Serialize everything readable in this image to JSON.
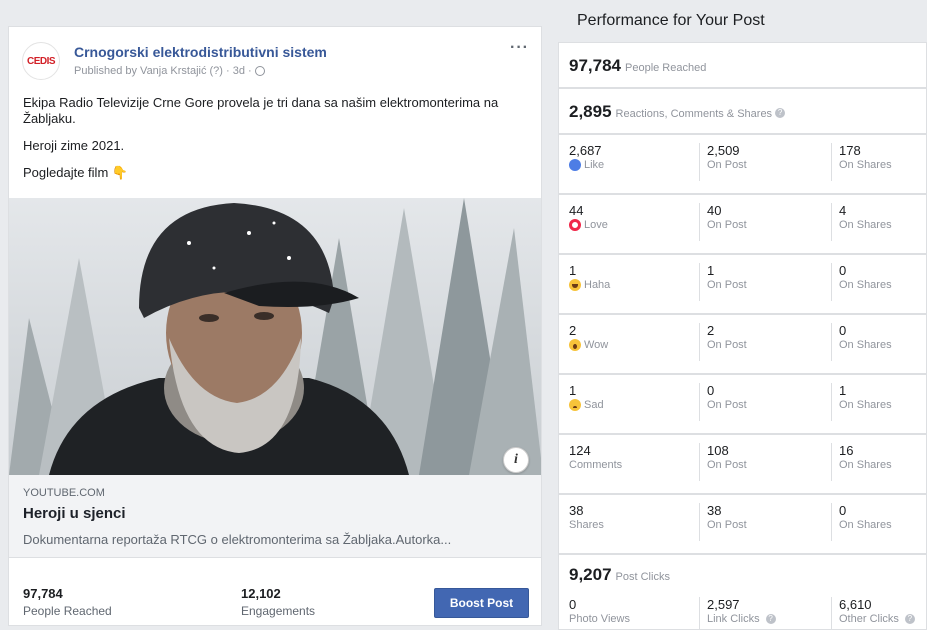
{
  "post": {
    "page_name": "Crnogorski elektrodistributivni sistem",
    "logo_text": "CEDIS",
    "published_by": "Published by Vanja Krstajić",
    "published_suffix": "(?) · 3d ·",
    "text_line1": "Ekipa Radio Televizije Crne Gore provela je tri dana sa našim elektromonterima na Žabljaku.",
    "text_line2": "Heroji zime 2021.",
    "text_line3": "Pogledajte film",
    "link_source": "YOUTUBE.COM",
    "link_title": "Heroji u sjenci",
    "link_desc": "Dokumentarna reportaža RTCG o elektromonterima sa Žabljaka.Autorka...",
    "reached_num": "97,784",
    "reached_label": "People Reached",
    "engagements_num": "12,102",
    "engagements_label": "Engagements",
    "boost_label": "Boost Post"
  },
  "panel": {
    "title": "Performance for Your Post",
    "people_reached_num": "97,784",
    "people_reached_label": "People Reached",
    "rcs_num": "2,895",
    "rcs_label": "Reactions, Comments & Shares",
    "reactions": [
      {
        "total": "2,687",
        "label": "Like",
        "icon": "like-icon",
        "on_post": "2,509",
        "on_shares": "178"
      },
      {
        "total": "44",
        "label": "Love",
        "icon": "love-icon",
        "on_post": "40",
        "on_shares": "4"
      },
      {
        "total": "1",
        "label": "Haha",
        "icon": "haha-icon",
        "on_post": "1",
        "on_shares": "0"
      },
      {
        "total": "2",
        "label": "Wow",
        "icon": "wow-icon",
        "on_post": "2",
        "on_shares": "0"
      },
      {
        "total": "1",
        "label": "Sad",
        "icon": "sad-icon",
        "on_post": "0",
        "on_shares": "1"
      },
      {
        "total": "124",
        "label": "Comments",
        "icon": "",
        "on_post": "108",
        "on_shares": "16"
      },
      {
        "total": "38",
        "label": "Shares",
        "icon": "",
        "on_post": "38",
        "on_shares": "0"
      }
    ],
    "on_post_label": "On Post",
    "on_shares_label": "On Shares",
    "post_clicks_num": "9,207",
    "post_clicks_label": "Post Clicks",
    "photo_views_num": "0",
    "photo_views_label": "Photo Views",
    "link_clicks_num": "2,597",
    "link_clicks_label": "Link Clicks",
    "other_clicks_num": "6,610",
    "other_clicks_label": "Other Clicks"
  }
}
